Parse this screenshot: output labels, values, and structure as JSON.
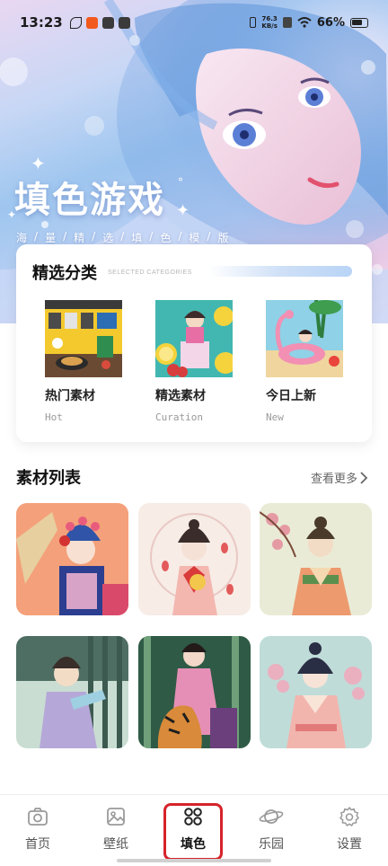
{
  "status_bar": {
    "time": "13:23",
    "net_speed_value": "76.3",
    "net_speed_unit": "KB/s",
    "battery": "66%"
  },
  "hero": {
    "title": "填色游戏",
    "subtitle_chars": [
      "海",
      "量",
      "精",
      "选",
      "填",
      "色",
      "模",
      "版"
    ]
  },
  "categories": {
    "title": "精选分类",
    "subtitle": "SELECTED CATEGORIES",
    "items": [
      {
        "label": "热门素材",
        "label_en": "Hot"
      },
      {
        "label": "精选素材",
        "label_en": "Curation"
      },
      {
        "label": "今日上新",
        "label_en": "New"
      }
    ]
  },
  "materials": {
    "title": "素材列表",
    "more_label": "查看更多"
  },
  "bottom_nav": {
    "items": [
      {
        "label": "首页",
        "icon": "camera-icon"
      },
      {
        "label": "壁纸",
        "icon": "image-icon"
      },
      {
        "label": "填色",
        "icon": "grid-icon",
        "active": true
      },
      {
        "label": "乐园",
        "icon": "planet-icon"
      },
      {
        "label": "设置",
        "icon": "gear-icon"
      }
    ]
  },
  "colors": {
    "highlight": "#d6232b",
    "hero_blue": "#9ec6ef",
    "text_primary": "#111111",
    "text_muted": "#9a9a9a"
  }
}
